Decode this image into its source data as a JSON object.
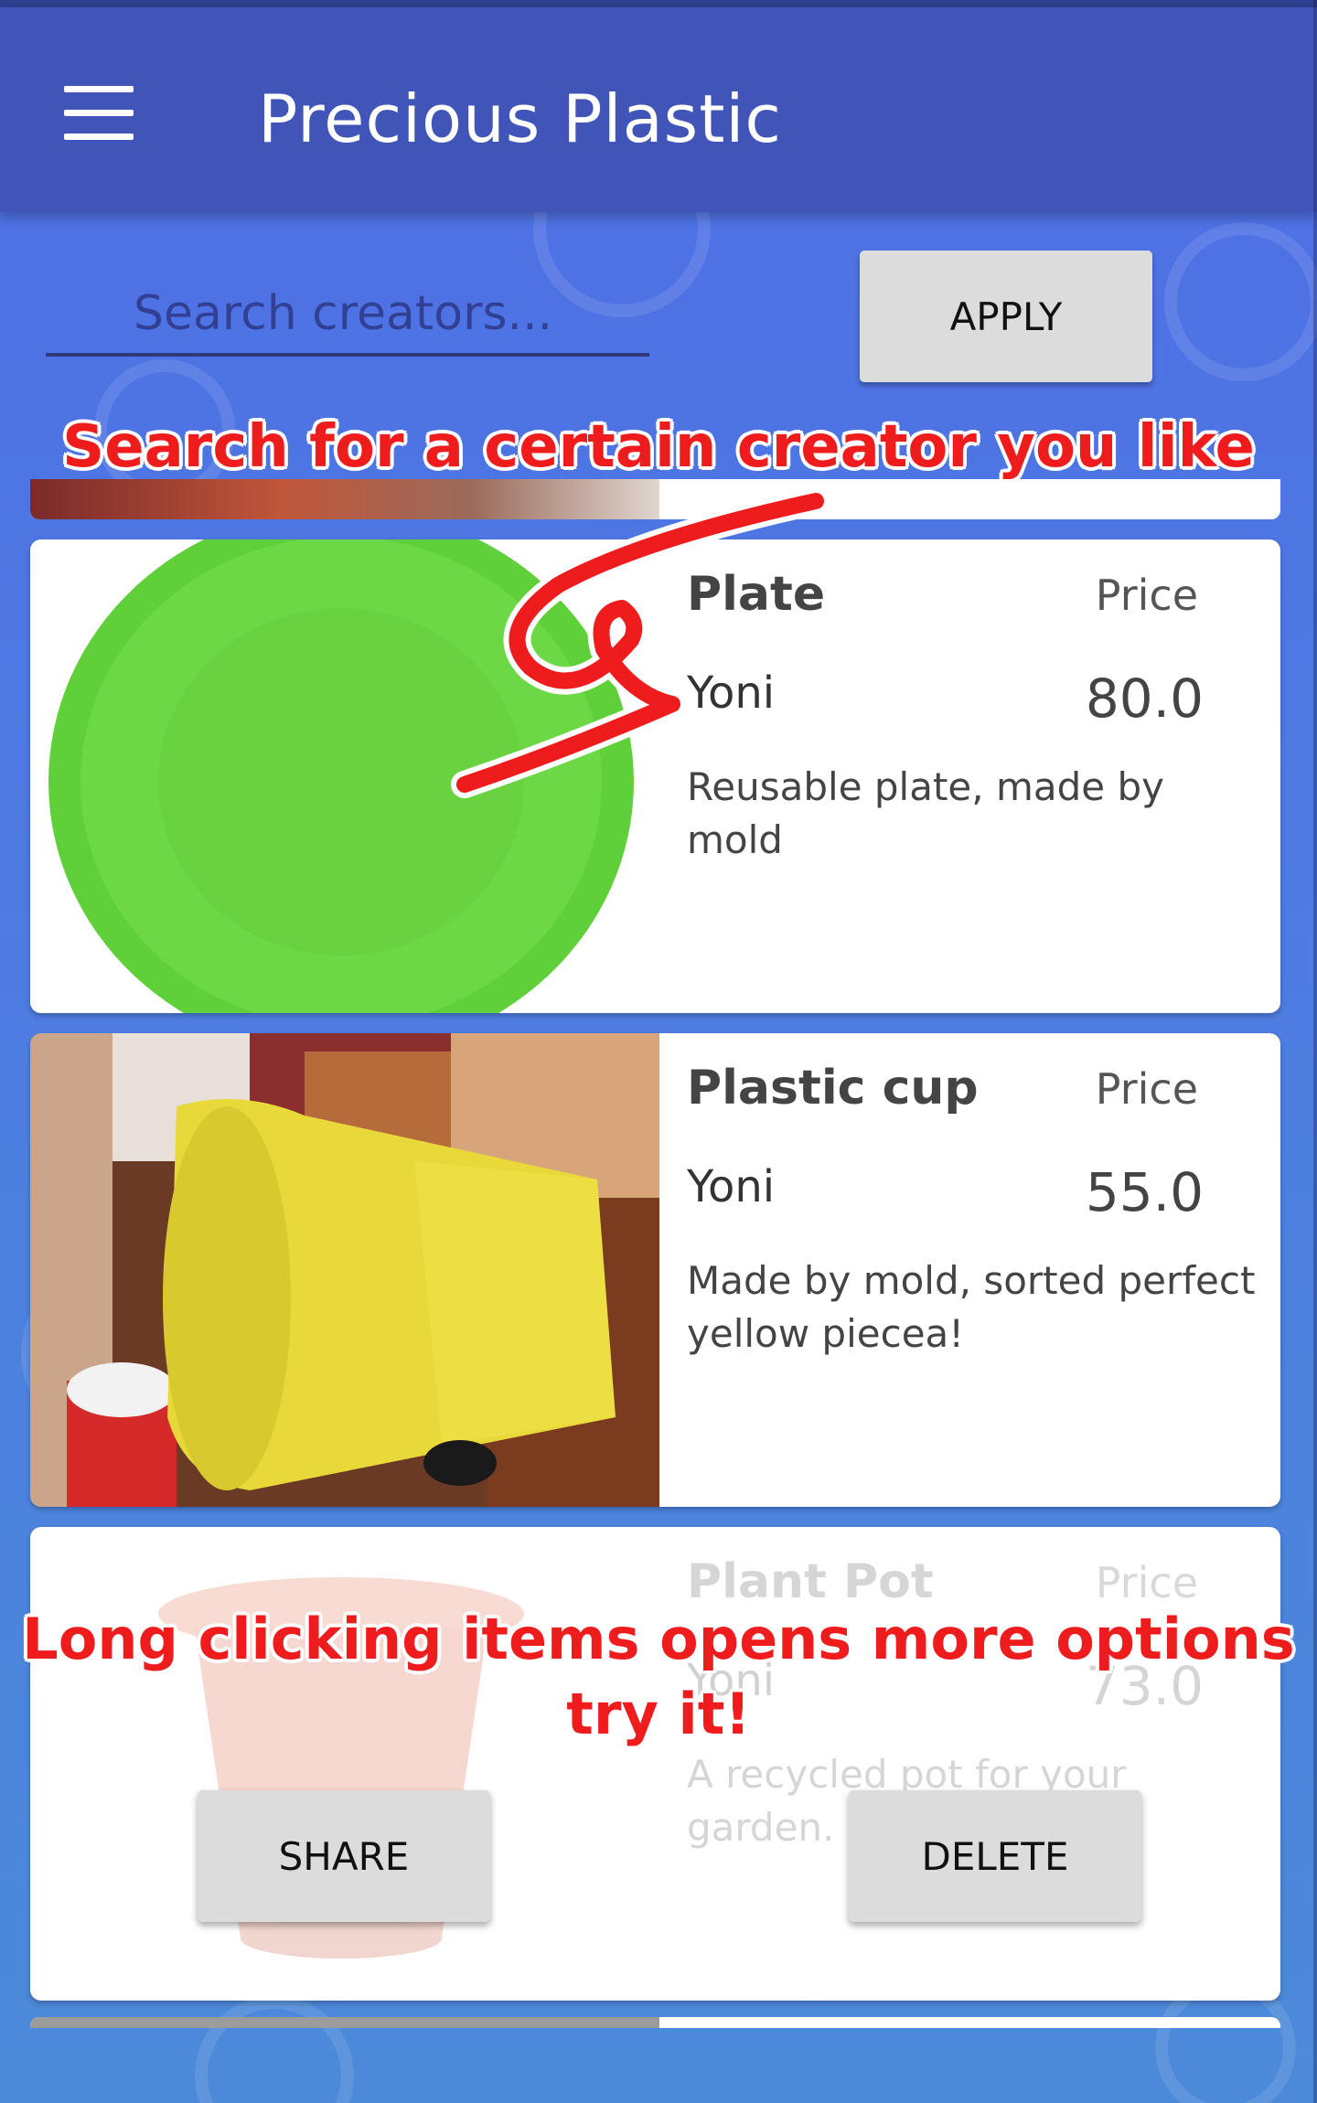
{
  "app": {
    "title": "Precious Plastic"
  },
  "search": {
    "placeholder": "Search creators...",
    "apply_label": "APPLY"
  },
  "hints": {
    "search_hint": "Search for a certain creator you like",
    "long_click_hint_line1": "Long clicking items opens more options",
    "long_click_hint_line2": "try it!"
  },
  "items": [
    {
      "name": "Plate",
      "price_label": "Price",
      "creator": "Yoni",
      "price": "80.0",
      "description": "Reusable plate, made by mold",
      "image": "green-plate"
    },
    {
      "name": "Plastic cup",
      "price_label": "Price",
      "creator": "Yoni",
      "price": "55.0",
      "description": "Made by mold, sorted perfect yellow piecea!",
      "image": "yellow-cup"
    },
    {
      "name": "Plant Pot",
      "price_label": "Price",
      "creator": "Yoni",
      "price": "73.0",
      "description": "A recycled pot for your garden.",
      "image": "plant-pot"
    }
  ],
  "context_menu": {
    "share_label": "SHARE",
    "delete_label": "DELETE"
  },
  "colors": {
    "appbar": "#4155b9",
    "background": "#4f6ee6",
    "hint_red": "#ee1c1c",
    "button_gray": "#dcdcdc",
    "plate_green": "#6cd845",
    "cup_yellow": "#e8d83a"
  },
  "icons": {
    "menu": "hamburger-menu-icon",
    "arrow": "hint-arrow-icon"
  }
}
